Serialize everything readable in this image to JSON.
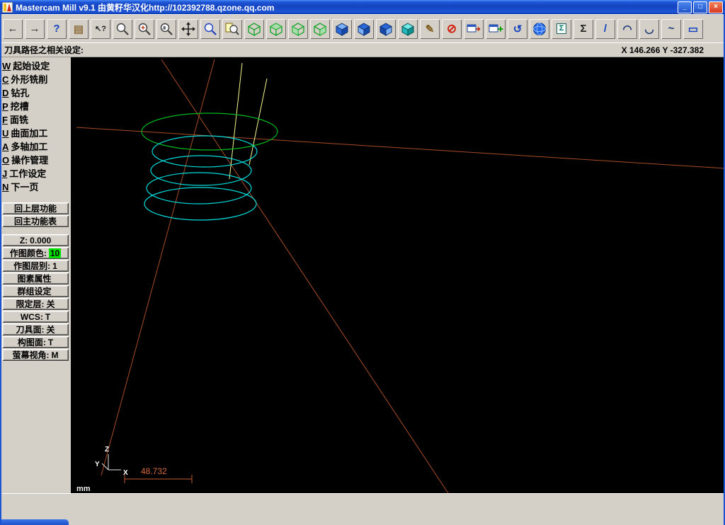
{
  "window": {
    "title": "Mastercam Mill v9.1 由黄籽华汉化http://102392788.qzone.qq.com"
  },
  "window_controls": {
    "minimize": "_",
    "restore": "□",
    "close": "×"
  },
  "icons": {
    "back": "←",
    "forward": "→",
    "help": "?",
    "analyze": "▤",
    "cursor_help": "↖?",
    "pencil": "✎",
    "delete": "⊘",
    "undo": "↺",
    "stats": "Σ",
    "sigma": "Σ",
    "line": "/",
    "arc_up": "◠",
    "arc_down": "◡",
    "spline": "~",
    "rect": "▭"
  },
  "prompt": {
    "text": "刀具路径之相关设定:",
    "coords": "X 146.266  Y -327.382"
  },
  "sidebar": {
    "menu": [
      {
        "key": "W",
        "label": "起始设定"
      },
      {
        "key": "C",
        "label": "外形铣削"
      },
      {
        "key": "D",
        "label": "钻孔"
      },
      {
        "key": "P",
        "label": "挖槽"
      },
      {
        "key": "F",
        "label": "面铣"
      },
      {
        "key": "U",
        "label": "曲面加工"
      },
      {
        "key": "A",
        "label": "多轴加工"
      },
      {
        "key": "O",
        "label": "操作管理"
      },
      {
        "key": "J",
        "label": "工作设定"
      },
      {
        "key": "N",
        "label": "下一页"
      }
    ],
    "back_button": "回上层功能",
    "main_menu_button": "回主功能表",
    "status": [
      {
        "label": "Z:",
        "value": "0.000"
      },
      {
        "label": "作图颜色:",
        "value": "10"
      },
      {
        "label": "作图层别:",
        "value": "1"
      },
      {
        "label": "图素属性",
        "value": ""
      },
      {
        "label": "群组设定",
        "value": ""
      },
      {
        "label": "限定层:",
        "value": "关"
      },
      {
        "label": "WCS:",
        "value": "T"
      },
      {
        "label": "刀具面:",
        "value": "关"
      },
      {
        "label": "构图面:",
        "value": "T"
      },
      {
        "label": "萤幕视角:",
        "value": "M"
      }
    ]
  },
  "canvas": {
    "dimension_label": "48.732",
    "units_label": "mm",
    "axis": {
      "x": "X",
      "y": "Y",
      "z": "Z"
    }
  },
  "colors": {
    "titlebar_blue": "#1c55d4",
    "toolpath_cyan": "#00dcdc",
    "toolpath_green": "#00b820",
    "construction_orange": "#a84c28",
    "dimension_orange": "#d46a40",
    "highlight_green": "#00e000",
    "canvas_black": "#000000"
  }
}
